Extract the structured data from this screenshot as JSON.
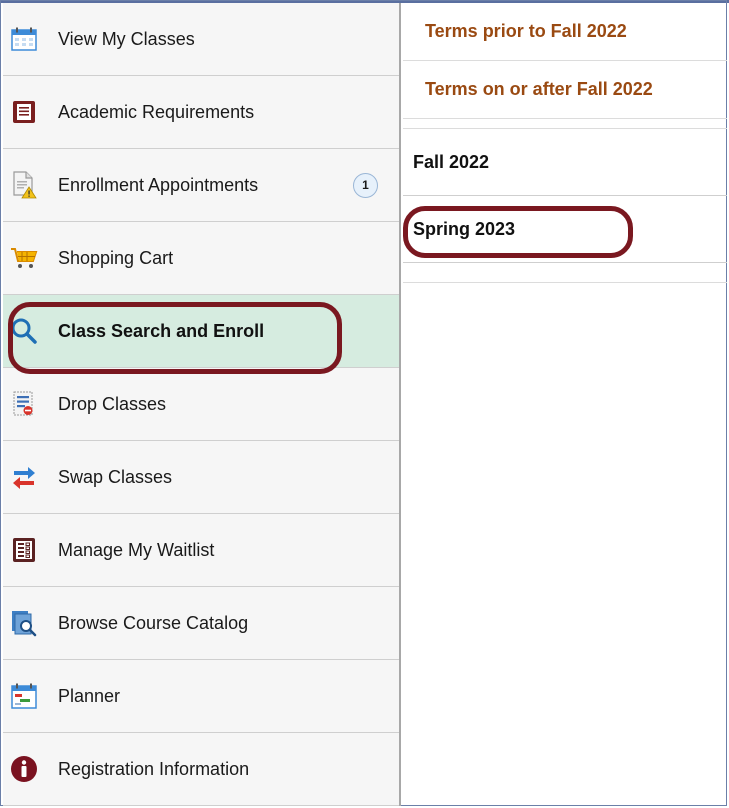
{
  "sidebar": {
    "items": [
      {
        "label": "View My Classes",
        "icon": "calendar-icon"
      },
      {
        "label": "Academic Requirements",
        "icon": "document-list-icon"
      },
      {
        "label": "Enrollment Appointments",
        "icon": "appointment-warning-icon",
        "badge": "1"
      },
      {
        "label": "Shopping Cart",
        "icon": "shopping-cart-icon"
      },
      {
        "label": "Class Search and Enroll",
        "icon": "search-icon",
        "active": true
      },
      {
        "label": "Drop Classes",
        "icon": "drop-list-icon"
      },
      {
        "label": "Swap Classes",
        "icon": "swap-arrows-icon"
      },
      {
        "label": "Manage My Waitlist",
        "icon": "waitlist-icon"
      },
      {
        "label": "Browse Course Catalog",
        "icon": "catalog-search-icon"
      },
      {
        "label": "Planner",
        "icon": "planner-icon"
      },
      {
        "label": "Registration Information",
        "icon": "info-icon"
      }
    ]
  },
  "terms": {
    "links": [
      {
        "label": "Terms prior to Fall 2022"
      },
      {
        "label": "Terms on or after Fall 2022"
      }
    ],
    "items": [
      {
        "label": "Fall 2022"
      },
      {
        "label": "Spring 2023"
      }
    ]
  },
  "colors": {
    "active_bg": "#d6ece0",
    "highlight": "#7a1820",
    "link": "#9a4a12"
  }
}
